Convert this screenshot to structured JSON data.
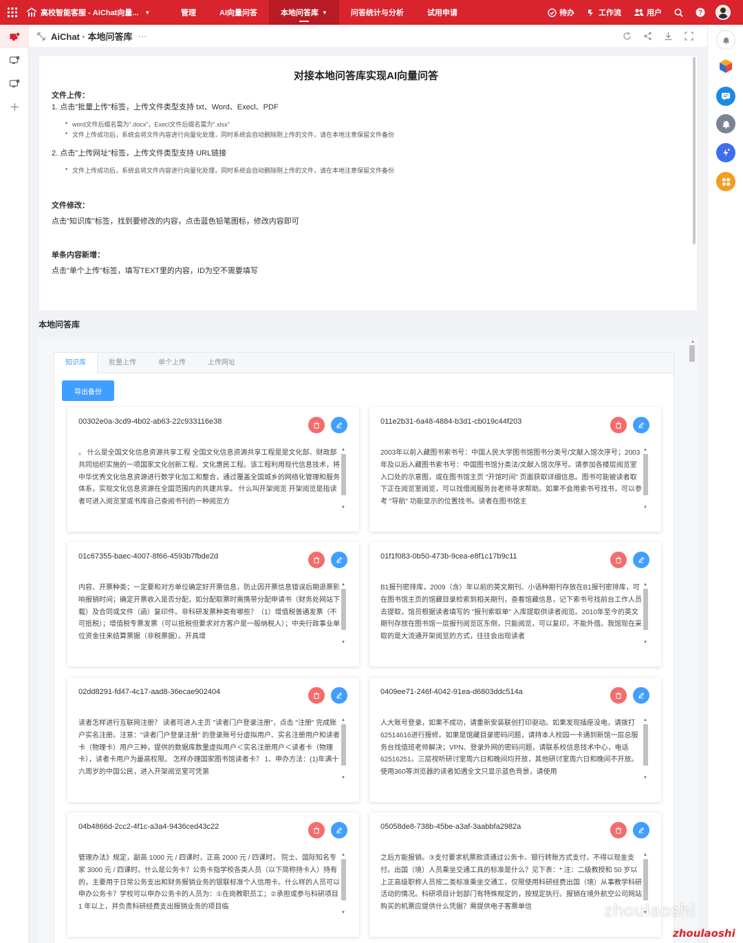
{
  "topbar": {
    "app_title": "高校智能客服 - AiChat向量...",
    "nav": [
      "管理",
      "AI向量问答",
      "本地问答库",
      "问答统计与分析",
      "试用申请"
    ],
    "active_nav": "本地问答库",
    "todo_label": "待办",
    "workflow_label": "工作流",
    "user_label": "用户"
  },
  "page_header": {
    "title": "AiChat · 本地问答库",
    "more": "···"
  },
  "doc": {
    "title": "对接本地问答库实现AI向量问答",
    "upload_heading": "文件上传：",
    "upload_item1": "1. 点击\"批量上传\"标签，上传文件类型支持 txt、Word、Execl、PDF",
    "upload_item1_b1": "word文件后缀名需为\".docx\"，Execl文件后缀名需为\".xlsx\"",
    "upload_item1_b2": "文件上传成功后，系统会将文件内容进行向量化处理，同时系统会自动删除刚上传的文件，请在本地注意保留文件备份",
    "upload_item2": "2. 点击\"上传网址\"标签，上传文件类型支持 URL链接",
    "upload_item2_b1": "文件上传成功后，系统会将文件内容进行向量化处理，同时系统会自动删除刚上传的文件，请在本地注意保留文件备份",
    "modify_heading": "文件修改：",
    "modify_text": "点击\"知识库\"标签，找到要修改的内容，点击蓝色铅笔图标，修改内容即可",
    "add_heading": "单条内容新增：",
    "add_text": "点击\"单个上传\"标签，填写TEXT里的内容，ID为空不需要填写"
  },
  "section_title": "本地问答库",
  "tabs": [
    "知识库",
    "批量上传",
    "单个上传",
    "上传网址"
  ],
  "active_tab": "知识库",
  "export_label": "导出备份",
  "cards": [
    {
      "id": "00302e0a-3cd9-4b02-ab63-22c933116e38",
      "text": "。 什么是全国文化信息资源共享工程 全国文化信息资源共享工程是是文化部、财政部共同组织实施的一项国家文化创新工程、文化惠民工程。该工程利用现代信息技术，将中华优秀文化信息资源进行数字化加工和整合，通过覆盖全国城乡的网络化管理和服务体系，实现文化信息资源在全国范围内的共建共享。 什么叫开架阅览 开架阅览是指读者可进入阅览室或书库自己查阅书刊的一种阅览方"
    },
    {
      "id": "011e2b31-6a48-4884-b3d1-cb019c44f203",
      "text": "2003年以前入藏图书索书号：中国人民大学图书馆图书分类号/文献入馆次序号；2003年及以后入藏图书索书号：中国图书馆分类法/文献入馆次序号。请参加各楼层阅览室入口处的示意图，或在图书馆主页 \"开馆时间\" 页面获取详细信息。图书可能被读者取下正在阅览室阅览，可以找借阅服务台老师寻求帮助。如果不会用索书号找书，可以参考 \"导航\" 功能显示的位置找书。读者在图书馆主"
    },
    {
      "id": "01c67355-baec-4007-8f66-4593b7fbde2d",
      "text": "内容、开票种类；一定要和对方单位确定好开票信息，防止因开票信息错误后期退票影响报销时间；确定开票收入是否分配，如分配取票时需携带分配申请书（财务处网站下载）及合同或文件（函）复印件。非科研发票种类有哪些？（1）增值税普通发票（不可抵税）；增值税专票发票（可以抵税但要求对方客户是一般纳税人）；中央行政事业单位资金往来结算票据（非税票据）。开具增"
    },
    {
      "id": "01f1f083-0b50-473b-9cea-e8f1c17b9c11",
      "text": "B1报刊密排库，2009（含）年以前的英文期刊、小语种期刊存放在B1报刊密排库，可在图书馆主页的馆藏目录检索到相关期刊，查看馆藏信息，记下索书号找前台工作人员去提取，馆员根据读者填写的 \"报刊索取单\" 入库提取供读者阅览。2010年至今的英文期刊存放在图书馆一层报刊阅览区东侧，只能阅览，可以复印，不能外借。我馆现在采取的是大流通开架阅览的方式，往往会出现读者"
    },
    {
      "id": "02dd8291-fd47-4c17-aad8-36ecae902404",
      "text": "读者怎样进行互联网注册？ 读者可进入主页 \"读者门户登录注册\"，点击 \"注册\" 完成账户实名注册。注意：\"读者门户登录注册\" 的登录账号分虚拟用户、实名注册用户和读者卡（物理卡）用户三种，提供的数据库数量虚拟用户＜实名注册用户＜读者卡（物理卡），读者卡用户为最高权限。 怎样办理国家图书馆读者卡？ 1、申办方法：(1)年满十六周岁的中国公民，进入开架阅览室可凭第"
    },
    {
      "id": "0409ee71-246f-4042-91ea-d6803ddc514a",
      "text": "人大账号登录，如果不成功，请重新安装联创打印驱动。如果发现插座没电，请拨打62514616进行报修。如果是馆藏目录密码问题，请持本人校园一卡通到新馆一层总服务台找值班老师解决；VPN、登录外网的密码问题，请联系校信息技术中心，电话62516251。三层视听研讨室周六日和晚间均开放，其他研讨室周六日和晚间不开放。使用360等浏览器的读者如遇全文只显示蓝色背景，请使用"
    },
    {
      "id": "04b4866d-2cc2-4f1c-a3a4-9436ced43c22",
      "text": "管理办法》规定，副高 1000 元 / 四课时，正高 2000 元 / 四课时， 院士、国际知名专家 3000 元 / 四课时。什么是公务卡？公务卡指学校各类人员（以下简称持卡人）持有的，主要用于日常公务支出和财务报销业务的银联标准个人信用卡。什么样的人员可以申办公务卡？学校可以申办公务卡的人员为：①在岗教职员工；②承担或参与科研项目 1 年以上，并负责科研经费支出报销业务的项目临"
    },
    {
      "id": "05058de8-738b-45be-a3af-3aabbfa2982a",
      "text": "之后方能报销。③支付要求机票款须通过公务卡、银行转账方式支付，不得以现金支付。出国（境）人员乘坐交通工具的标准是什么？见下表：* 注：二级教授和 50 岁以上正高级职称人员按二类标准乘坐交通工，仅限使用科研经费出国（境）从事教学科研活动的情况。科研项目计划部门有特殊规定的，按规定执行。报销在境外航空公司网站购买的机票应提供什么凭据？需提供电子客票单信"
    }
  ],
  "watermark": "zhoulaoshi",
  "watermark_brand": "zhoulaoshi"
}
